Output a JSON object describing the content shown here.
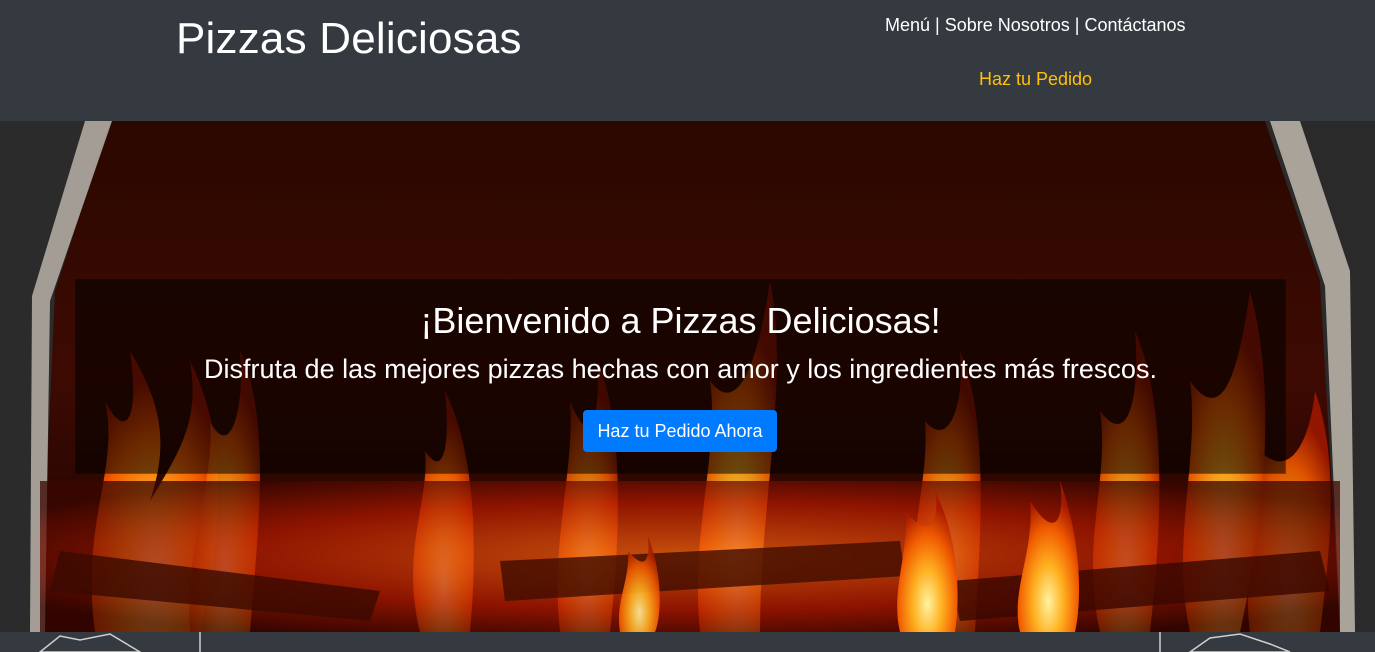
{
  "header": {
    "site_title": "Pizzas Deliciosas",
    "nav": {
      "items": [
        "Menú",
        "Sobre Nosotros",
        "Contáctanos"
      ],
      "separator": "|"
    },
    "order_link": "Haz tu Pedido"
  },
  "hero": {
    "title": "¡Bienvenido a Pizzas Deliciosas!",
    "subtitle": "Disfruta de las mejores pizzas hechas con amor y los ingredientes más frescos.",
    "button_label": "Haz tu Pedido Ahora",
    "background_image": "fireplace-flames"
  },
  "colors": {
    "header_bg": "#343a40",
    "nav_text": "#ffffff",
    "order_link": "#ffc107",
    "button_bg": "#007bff"
  }
}
